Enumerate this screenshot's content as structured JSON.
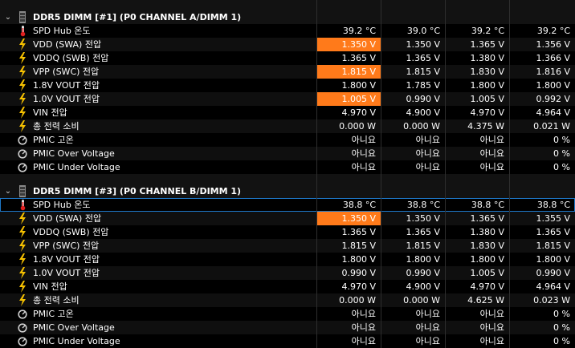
{
  "theme": {
    "highlight": "#ff7a1a",
    "selection_border": "#1e78c8",
    "thermometer_icon": "thermometer-icon",
    "voltage_icon": "lightning-icon",
    "status_icon": "gauge-icon",
    "group_icon": "memory-module-icon"
  },
  "groups": [
    {
      "title": "DDR5 DIMM [#1] (P0 CHANNEL A/DIMM 1)",
      "rows": [
        {
          "icon": "thermometer",
          "label": "SPD Hub 온도",
          "values": [
            "39.2 °C",
            "39.0 °C",
            "39.2 °C",
            "39.2 °C"
          ],
          "hl": false
        },
        {
          "icon": "bolt",
          "label": "VDD (SWA) 전압",
          "values": [
            "1.350 V",
            "1.350 V",
            "1.365 V",
            "1.356 V"
          ],
          "hl": true
        },
        {
          "icon": "bolt",
          "label": "VDDQ (SWB) 전압",
          "values": [
            "1.365 V",
            "1.365 V",
            "1.380 V",
            "1.366 V"
          ],
          "hl": false
        },
        {
          "icon": "bolt",
          "label": "VPP (SWC) 전압",
          "values": [
            "1.815 V",
            "1.815 V",
            "1.830 V",
            "1.816 V"
          ],
          "hl": true
        },
        {
          "icon": "bolt",
          "label": "1.8V VOUT 전압",
          "values": [
            "1.800 V",
            "1.785 V",
            "1.800 V",
            "1.800 V"
          ],
          "hl": false
        },
        {
          "icon": "bolt",
          "label": "1.0V VOUT 전압",
          "values": [
            "1.005 V",
            "0.990 V",
            "1.005 V",
            "0.992 V"
          ],
          "hl": true
        },
        {
          "icon": "bolt",
          "label": "VIN 전압",
          "values": [
            "4.970 V",
            "4.900 V",
            "4.970 V",
            "4.964 V"
          ],
          "hl": false
        },
        {
          "icon": "bolt",
          "label": "총 전력 소비",
          "values": [
            "0.000 W",
            "0.000 W",
            "4.375 W",
            "0.021 W"
          ],
          "hl": false
        },
        {
          "icon": "gauge",
          "label": "PMIC 고온",
          "values": [
            "아니요",
            "아니요",
            "아니요",
            "0 %"
          ],
          "hl": false
        },
        {
          "icon": "gauge",
          "label": "PMIC Over Voltage",
          "values": [
            "아니요",
            "아니요",
            "아니요",
            "0 %"
          ],
          "hl": false
        },
        {
          "icon": "gauge",
          "label": "PMIC Under Voltage",
          "values": [
            "아니요",
            "아니요",
            "아니요",
            "0 %"
          ],
          "hl": false
        }
      ]
    },
    {
      "title": "DDR5 DIMM [#3] (P0 CHANNEL B/DIMM 1)",
      "rows": [
        {
          "icon": "thermometer",
          "label": "SPD Hub 온도",
          "values": [
            "38.8 °C",
            "38.8 °C",
            "38.8 °C",
            "38.8 °C"
          ],
          "hl": false,
          "selected": true
        },
        {
          "icon": "bolt",
          "label": "VDD (SWA) 전압",
          "values": [
            "1.350 V",
            "1.350 V",
            "1.365 V",
            "1.355 V"
          ],
          "hl": true
        },
        {
          "icon": "bolt",
          "label": "VDDQ (SWB) 전압",
          "values": [
            "1.365 V",
            "1.365 V",
            "1.380 V",
            "1.365 V"
          ],
          "hl": false
        },
        {
          "icon": "bolt",
          "label": "VPP (SWC) 전압",
          "values": [
            "1.815 V",
            "1.815 V",
            "1.830 V",
            "1.815 V"
          ],
          "hl": false
        },
        {
          "icon": "bolt",
          "label": "1.8V VOUT 전압",
          "values": [
            "1.800 V",
            "1.800 V",
            "1.800 V",
            "1.800 V"
          ],
          "hl": false
        },
        {
          "icon": "bolt",
          "label": "1.0V VOUT 전압",
          "values": [
            "0.990 V",
            "0.990 V",
            "1.005 V",
            "0.990 V"
          ],
          "hl": false
        },
        {
          "icon": "bolt",
          "label": "VIN 전압",
          "values": [
            "4.970 V",
            "4.900 V",
            "4.970 V",
            "4.964 V"
          ],
          "hl": false
        },
        {
          "icon": "bolt",
          "label": "총 전력 소비",
          "values": [
            "0.000 W",
            "0.000 W",
            "4.625 W",
            "0.023 W"
          ],
          "hl": false
        },
        {
          "icon": "gauge",
          "label": "PMIC 고온",
          "values": [
            "아니요",
            "아니요",
            "아니요",
            "0 %"
          ],
          "hl": false
        },
        {
          "icon": "gauge",
          "label": "PMIC Over Voltage",
          "values": [
            "아니요",
            "아니요",
            "아니요",
            "0 %"
          ],
          "hl": false
        },
        {
          "icon": "gauge",
          "label": "PMIC Under Voltage",
          "values": [
            "아니요",
            "아니요",
            "아니요",
            "0 %"
          ],
          "hl": false
        }
      ]
    }
  ]
}
